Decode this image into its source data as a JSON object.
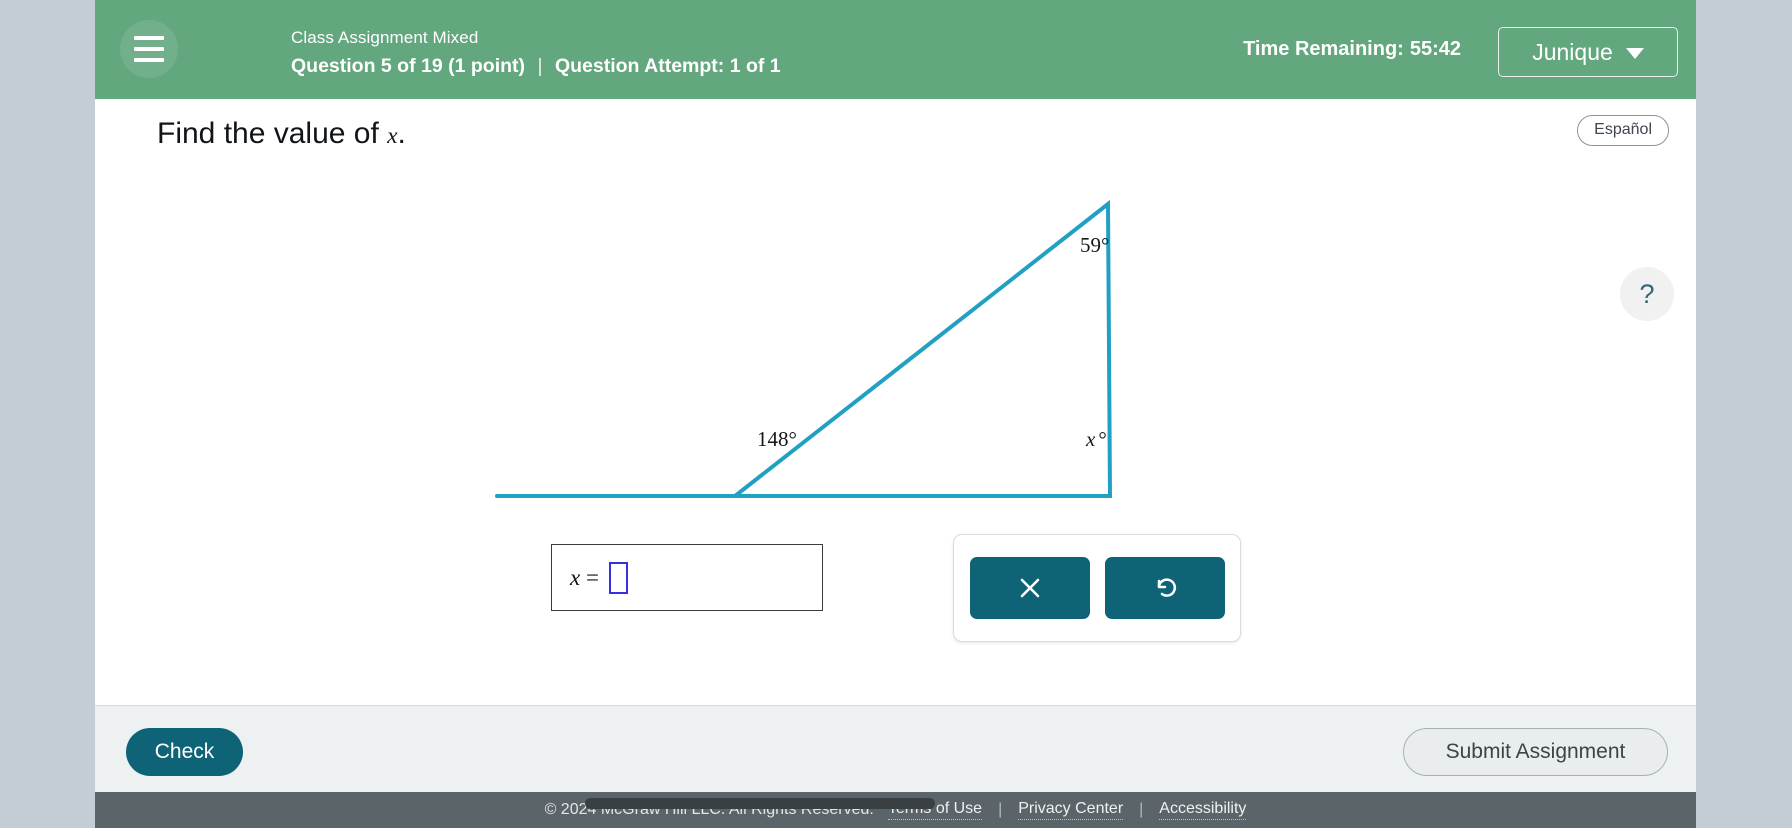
{
  "header": {
    "menu_icon": "hamburger-icon",
    "assignment_title": "Class Assignment Mixed",
    "question_progress": "Question 5 of 19 (1 point)",
    "separator": "|",
    "attempt": "Question Attempt: 1 of 1",
    "timer_label": "Time Remaining:",
    "timer_value": "55:42",
    "user_name": "Junique",
    "user_caret_icon": "chevron-down-icon",
    "bg_color": "#62a77e"
  },
  "body": {
    "espanol_label": "Español",
    "prompt_prefix": "Find the value of ",
    "prompt_variable": "x",
    "prompt_suffix": ".",
    "help_icon": "question-mark-icon",
    "help_label": "?"
  },
  "figure": {
    "type": "geometry-triangle",
    "stroke_color": "#21a0c4",
    "angle_left_exterior": "148°",
    "angle_top": "59°",
    "angle_right_variable": "x",
    "angle_right_degree": "°"
  },
  "answer": {
    "variable": "x",
    "equals": "=",
    "input_value": "",
    "input_placeholder": ""
  },
  "tools": {
    "clear_icon": "x-icon",
    "clear_label": "Clear",
    "undo_icon": "undo-arrow-icon",
    "undo_label": "Undo",
    "button_color": "#0f6377"
  },
  "actions": {
    "check_label": "Check",
    "submit_label": "Submit Assignment"
  },
  "footer": {
    "copyright": "© 2024 McGraw Hill LLC. All Rights Reserved.",
    "links": [
      {
        "label": "Terms of Use"
      },
      {
        "label": "Privacy Center"
      },
      {
        "label": "Accessibility"
      }
    ],
    "separator": "|"
  }
}
